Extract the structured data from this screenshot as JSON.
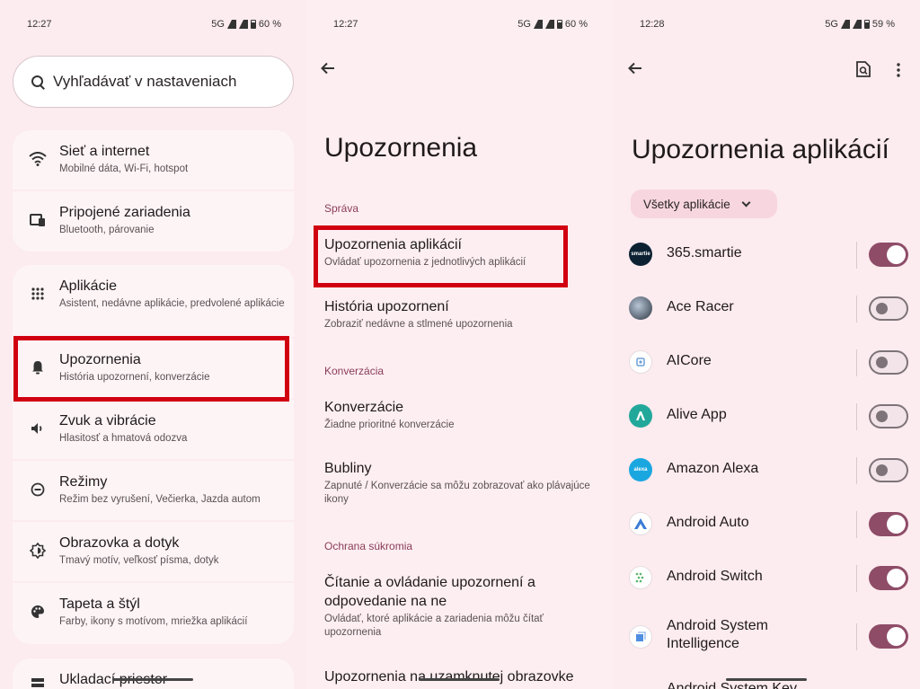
{
  "panel1": {
    "status": {
      "time": "12:27",
      "network": "5G",
      "battery": "60 %"
    },
    "search_placeholder": "Vyhľadávať v nastaveniach",
    "groups": [
      {
        "items": [
          {
            "icon": "wifi-icon",
            "title": "Sieť a internet",
            "subtitle": "Mobilné dáta, Wi‑Fi, hotspot"
          },
          {
            "icon": "devices-icon",
            "title": "Pripojené zariadenia",
            "subtitle": "Bluetooth, párovanie"
          }
        ]
      },
      {
        "items": [
          {
            "icon": "apps-icon",
            "title": "Aplikácie",
            "subtitle": "Asistent, nedávne aplikácie, predvolené aplikácie"
          },
          {
            "icon": "bell-icon",
            "title": "Upozornenia",
            "subtitle": "História upozornení, konverzácie"
          },
          {
            "icon": "volume-icon",
            "title": "Zvuk a vibrácie",
            "subtitle": "Hlasitosť a hmatová odozva"
          },
          {
            "icon": "mode-icon",
            "title": "Režimy",
            "subtitle": "Režim bez vyrušení, Večierka, Jazda autom"
          },
          {
            "icon": "display-icon",
            "title": "Obrazovka a dotyk",
            "subtitle": "Tmavý motív, veľkosť písma, dotyk"
          },
          {
            "icon": "palette-icon",
            "title": "Tapeta a štýl",
            "subtitle": "Farby, ikony s motívom, mriežka aplikácií"
          }
        ]
      },
      {
        "items": [
          {
            "icon": "storage-icon",
            "title": "Ukladací priestor",
            "subtitle": ""
          }
        ]
      }
    ]
  },
  "panel2": {
    "status": {
      "time": "12:27",
      "network": "5G",
      "battery": "60 %"
    },
    "title": "Upozornenia",
    "sections": {
      "sprava": "Správa",
      "konverzacia": "Konverzácia",
      "ochrana": "Ochrana súkromia"
    },
    "items": {
      "app_notifications": {
        "title": "Upozornenia aplikácií",
        "subtitle": "Ovládať upozornenia z jednotlivých aplikácií"
      },
      "history": {
        "title": "História upozornení",
        "subtitle": "Zobraziť nedávne a stlmené upozornenia"
      },
      "conversations": {
        "title": "Konverzácie",
        "subtitle": "Žiadne prioritné konverzácie"
      },
      "bubbles": {
        "title": "Bubliny",
        "subtitle": "Zapnuté / Konverzácie sa môžu zobrazovať ako plávajúce ikony"
      },
      "read_reply": {
        "title": "Čítanie a ovládanie upozornení a odpovedanie na ne",
        "subtitle": "Ovládať, ktoré aplikácie a zariadenia môžu čítať upozornenia"
      },
      "lockscreen": {
        "title": "Upozornenia na uzamknutej obrazovke",
        "subtitle": ""
      }
    }
  },
  "panel3": {
    "status": {
      "time": "12:28",
      "network": "5G",
      "battery": "59 %"
    },
    "title": "Upozornenia aplikácií",
    "filter": "Všetky aplikácie",
    "apps": [
      {
        "name": "365.smartie",
        "on": true,
        "color": "#0c2233",
        "glyph": "smartie"
      },
      {
        "name": "Ace Racer",
        "on": false,
        "color": "#3a4a5c",
        "glyph": ""
      },
      {
        "name": "AICore",
        "on": false,
        "color": "#ffffff",
        "glyph": ""
      },
      {
        "name": "Alive App",
        "on": false,
        "color": "#22a89a",
        "glyph": ""
      },
      {
        "name": "Amazon Alexa",
        "on": false,
        "color": "#1aa7e0",
        "glyph": "alexa"
      },
      {
        "name": "Android Auto",
        "on": true,
        "color": "#ffffff",
        "glyph": ""
      },
      {
        "name": "Android Switch",
        "on": true,
        "color": "#ffffff",
        "glyph": ""
      },
      {
        "name": "Android System Intelligence",
        "on": true,
        "color": "#ffffff",
        "glyph": ""
      },
      {
        "name": "Android System Key",
        "on": true,
        "color": "#ffffff",
        "glyph": ""
      }
    ]
  }
}
